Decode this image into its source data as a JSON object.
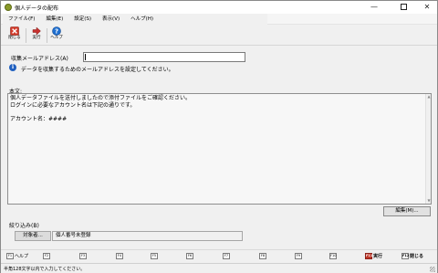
{
  "window": {
    "title": "個人データの配布",
    "min_glyph": "—",
    "close_glyph": "✕"
  },
  "menu": [
    "ファイル(F)",
    "編集(E)",
    "設定(S)",
    "表示(V)",
    "ヘルプ(H)"
  ],
  "toolbar": {
    "close_label": "閉じる",
    "run_label": "実行",
    "help_label": "ヘルプ"
  },
  "form": {
    "address_label": "収集メールアドレス(A)",
    "address_value": "",
    "info_glyph": "i",
    "info_text": "データを収集するためのメールアドレスを設定してください。",
    "body_label": "本文:",
    "body_text": "個人データファイルを送付しましたので添付ファイルをご確認ください。\nログインに必要なアカウント名は下記の通りです。\n\nアカウント名：####",
    "edit_button": "編集(M)...",
    "filter_label": "絞り込み(B)",
    "filter_button": "対象者...",
    "filter_value": "個人番号未登録"
  },
  "fkeys": {
    "help": {
      "key": "F1",
      "label": "ヘルプ"
    },
    "f2": "F2",
    "f3": "F3",
    "f4": "F4",
    "f5": "F5",
    "f6": "F6",
    "f7": "F7",
    "f8": "F8",
    "f9": "F9",
    "f10": "F10",
    "run": {
      "key": "F11",
      "label": "実行"
    },
    "close": {
      "key": "F12",
      "label": "閉じる"
    }
  },
  "status": {
    "text": "半角128文字以内で入力してください。"
  },
  "colors": {
    "close_icon": "#d23a2a",
    "run_arrow": "#c8312f",
    "help_icon": "#1f6fd0",
    "info_icon": "#1f5fbf"
  }
}
